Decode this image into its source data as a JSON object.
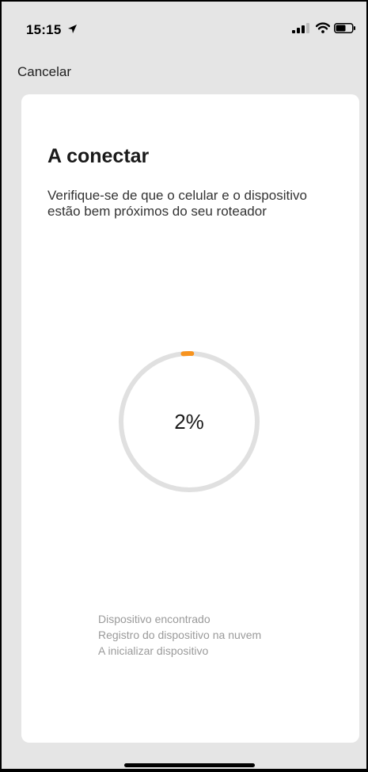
{
  "status_bar": {
    "time": "15:15",
    "icons": [
      "location-arrow-icon",
      "cellular-signal-icon",
      "wifi-icon",
      "battery-icon"
    ]
  },
  "nav": {
    "cancel_label": "Cancelar"
  },
  "card": {
    "title": "A conectar",
    "description": "Verifique-se de que o celular e o dispositivo estão bem próximos do seu roteador"
  },
  "progress": {
    "value": 0.02,
    "label": "2%",
    "track_color": "#e0e0e0",
    "fill_color": "#f7931e"
  },
  "steps": [
    "Dispositivo encontrado",
    "Registro do dispositivo na nuvem",
    "A inicializar dispositivo"
  ],
  "colors": {
    "background": "#e5e5e5",
    "card": "#ffffff",
    "accent": "#f7931e"
  }
}
